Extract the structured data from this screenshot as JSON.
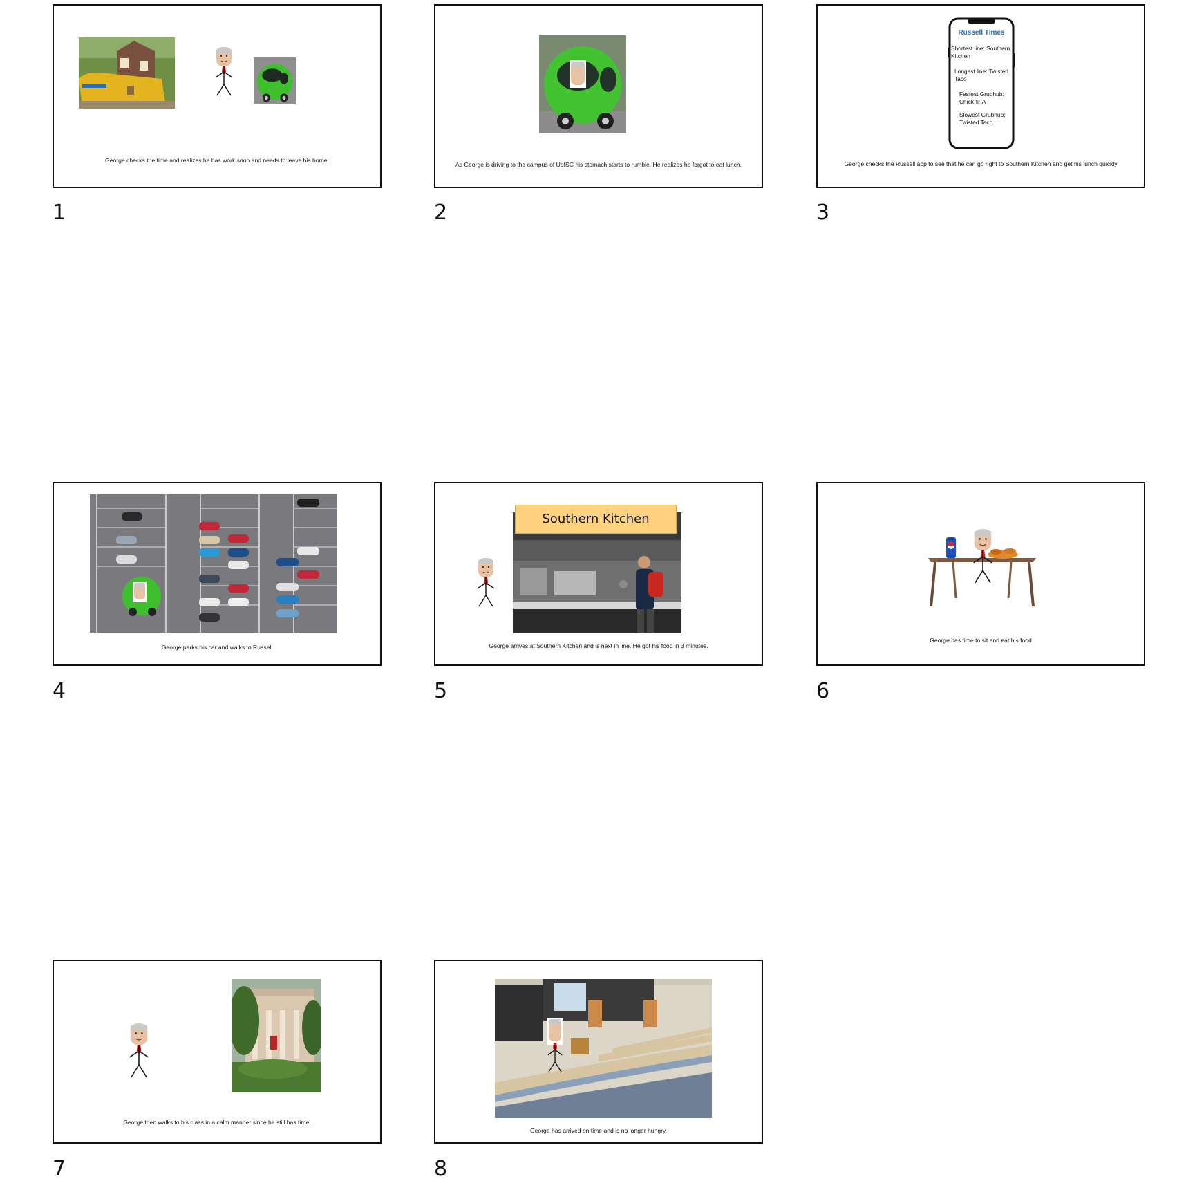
{
  "slides": [
    {
      "number": "1",
      "caption": "George checks the time and realizes he has work soon and needs to leave his home."
    },
    {
      "number": "2",
      "caption": "As George is driving to the campus of UofSC his stomach starts to rumble. He realizes he forgot to eat lunch."
    },
    {
      "number": "3",
      "caption": "George checks the Russell app to see that he can go right to Southern Kitchen and get his lunch quickly",
      "phone": {
        "title": "Russell Times",
        "lines": [
          "Shortest line: Southern Kitchen",
          "Longest line: Twisted Taco",
          "Fastest Grubhub: Chick-fil-A",
          "Slowest Grubhub: Twisted Taco"
        ]
      }
    },
    {
      "number": "4",
      "caption": "George parks his car and walks to Russell"
    },
    {
      "number": "5",
      "caption": "George arrives at Southern Kitchen and is next in line. He got his food in 3 minutes.",
      "banner": "Southern Kitchen"
    },
    {
      "number": "6",
      "caption": "George has time to sit and eat his food"
    },
    {
      "number": "7",
      "caption": "George then walks to his class in a calm manner since he still has time."
    },
    {
      "number": "8",
      "caption": "George has arrived on time and is no longer hungry."
    }
  ]
}
